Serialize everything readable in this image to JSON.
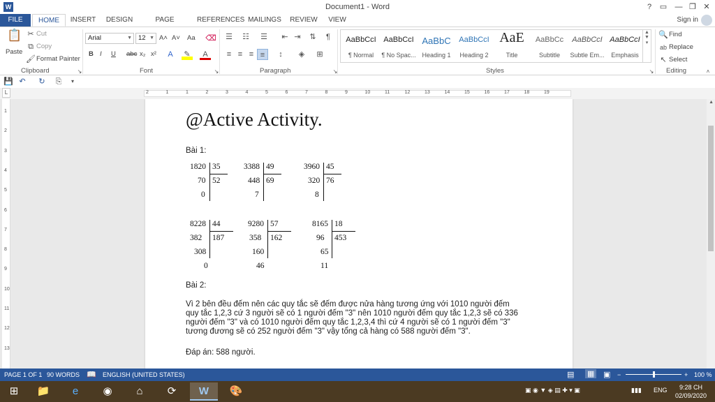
{
  "window": {
    "title": "Document1 - Word",
    "app_icon": "W",
    "help": "?",
    "ribbon_display": "▭",
    "minimize": "—",
    "restore": "❐",
    "close": "✕"
  },
  "tabs": {
    "file": "FILE",
    "items": [
      "HOME",
      "INSERT",
      "DESIGN",
      "PAGE LAYOUT",
      "REFERENCES",
      "MAILINGS",
      "REVIEW",
      "VIEW"
    ],
    "sign_in": "Sign in"
  },
  "ribbon": {
    "clipboard": {
      "paste": "Paste",
      "cut": "Cut",
      "copy": "Copy",
      "format_painter": "Format Painter",
      "label": "Clipboard"
    },
    "font": {
      "name": "Arial",
      "size": "12",
      "label": "Font",
      "bold": "B",
      "italic": "I",
      "underline": "U",
      "strike": "abc",
      "sub": "x₂",
      "sup": "x²",
      "grow": "A˄",
      "shrink": "A˅",
      "case": "Aa"
    },
    "paragraph": {
      "label": "Paragraph"
    },
    "styles": {
      "label": "Styles",
      "items": [
        {
          "preview": "AaBbCcI",
          "name": "¶ Normal"
        },
        {
          "preview": "AaBbCcI",
          "name": "¶ No Spac..."
        },
        {
          "preview": "AaBbC",
          "name": "Heading 1"
        },
        {
          "preview": "AaBbCcI",
          "name": "Heading 2"
        },
        {
          "preview": "AaE",
          "name": "Title"
        },
        {
          "preview": "AaBbCc",
          "name": "Subtitle"
        },
        {
          "preview": "AaBbCcI",
          "name": "Subtle Em..."
        },
        {
          "preview": "AaBbCcI",
          "name": "Emphasis"
        }
      ]
    },
    "editing": {
      "find": "Find",
      "replace": "Replace",
      "select": "Select",
      "label": "Editing"
    }
  },
  "ruler": {
    "marks": [
      "2",
      "1",
      "1",
      "2",
      "3",
      "4",
      "5",
      "6",
      "7",
      "8",
      "9",
      "10",
      "11",
      "12",
      "13",
      "14",
      "15",
      "16",
      "17",
      "18",
      "19"
    ],
    "vmarks": [
      "1",
      "2",
      "3",
      "4",
      "5",
      "6",
      "7",
      "8",
      "9",
      "10",
      "11",
      "12",
      "13"
    ]
  },
  "document": {
    "heading": "@Active Activity.",
    "bai1": "Bài 1:",
    "divisions_row1": [
      {
        "dividend": "1820",
        "divisor": "35",
        "steps": [
          "70",
          "0"
        ],
        "quotient": "52"
      },
      {
        "dividend": "3388",
        "divisor": "49",
        "steps": [
          "448",
          "7"
        ],
        "quotient": "69"
      },
      {
        "dividend": "3960",
        "divisor": "45",
        "steps": [
          "320",
          "8"
        ],
        "quotient": "76"
      }
    ],
    "divisions_row2": [
      {
        "dividend": "8228",
        "divisor": "44",
        "steps": [
          "382",
          "308",
          "0"
        ],
        "quotient": "187"
      },
      {
        "dividend": "9280",
        "divisor": "57",
        "steps": [
          "358",
          "160",
          "46"
        ],
        "quotient": "162"
      },
      {
        "dividend": "8165",
        "divisor": "18",
        "steps": [
          "96",
          "65",
          "11"
        ],
        "quotient": "453"
      }
    ],
    "bai2": "Bài 2:",
    "paragraph_lines": [
      "Vì 2 bên đều đếm nên các quy tắc sẽ đếm được nửa hàng tương ứng với 1010 người đếm",
      "quy tắc 1,2,3 cứ 3 người sẽ có 1 người đếm \"3\" nên 1010 người đếm quy tắc 1,2,3 sẽ có 336",
      "người đếm \"3\" và có 1010 người đếm quy tắc 1,2,3,4 thì cứ 4 người sẽ có 1 người đếm \"3\"",
      "tương đương sẽ có 252 người đếm \"3\" vậy tổng cả hàng có 588 người đếm \"3\"."
    ],
    "answer": "Đáp án: 588 người."
  },
  "statusbar": {
    "page": "PAGE 1 OF 1",
    "words": "90 WORDS",
    "language": "ENGLISH (UNITED STATES)",
    "zoom": "100 %",
    "zoom_level": 1.0
  },
  "taskbar": {
    "lang": "ENG",
    "time": "9:28 CH",
    "date": "02/09/2020"
  },
  "colors": {
    "accent": "#2b579a",
    "taskbar": "#4b3a22"
  }
}
